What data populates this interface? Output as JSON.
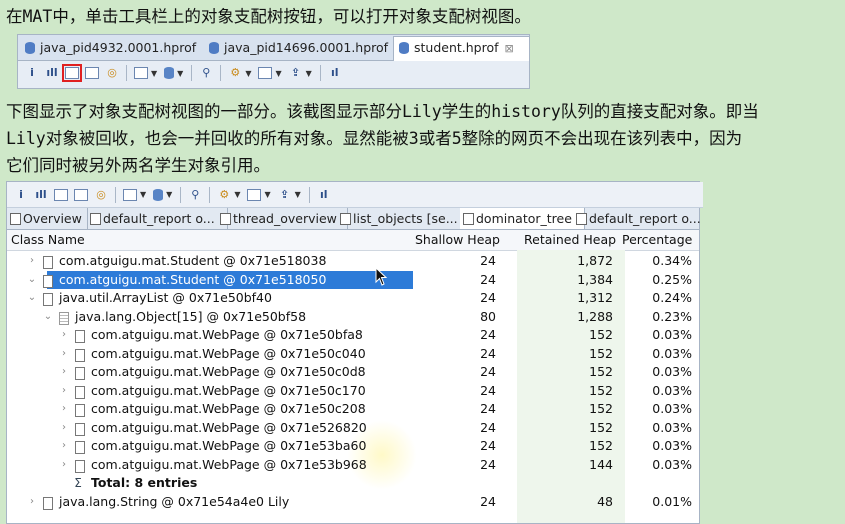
{
  "intro": {
    "line1_a": "在",
    "line1_mat": "MAT",
    "line1_b": "中，单击工具栏上的对象支配树按钮，可以打开对象支配树视图。"
  },
  "editor_tabs": [
    {
      "label": "java_pid4932.0001.hprof"
    },
    {
      "label": "java_pid14696.0001.hprof"
    },
    {
      "label": "student.hprof",
      "close": "⊠"
    }
  ],
  "paragraph2": {
    "l1a": "下图显示了对象支配树视图的一部分。该截图显示部分",
    "l1b": "Lily",
    "l1c": "学生的",
    "l1d": "history",
    "l1e": "队列的直接支配对象。即当",
    "l2a": "Lily",
    "l2b": "对象被回收，也会一并回收的所有对象。显然能被",
    "l2c": "3",
    "l2d": "或者",
    "l2e": "5",
    "l2f": "整除的网页不会出现在该列表中，因为",
    "l3": "它们同时被另外两名学生对象引用。"
  },
  "view_tabs": [
    {
      "label": "Overview"
    },
    {
      "label": "default_report  o..."
    },
    {
      "label": "thread_overview"
    },
    {
      "label": "list_objects  [se..."
    },
    {
      "label": "dominator_tree"
    },
    {
      "label": "default_report  o..."
    }
  ],
  "columns": {
    "class_name": "Class Name",
    "shallow": "Shallow Heap",
    "retained": "Retained Heap",
    "percentage": "Percentage"
  },
  "rows": [
    {
      "name": "com.atguigu.mat.Student @ 0x71e518038",
      "shallow": "24",
      "retained": "1,872",
      "pct": "0.34%"
    },
    {
      "name": "com.atguigu.mat.Student @ 0x71e518050",
      "shallow": "24",
      "retained": "1,384",
      "pct": "0.25%"
    },
    {
      "name": "java.util.ArrayList @ 0x71e50bf40",
      "shallow": "24",
      "retained": "1,312",
      "pct": "0.24%"
    },
    {
      "name": "java.lang.Object[15] @ 0x71e50bf58",
      "shallow": "80",
      "retained": "1,288",
      "pct": "0.23%"
    },
    {
      "name": "com.atguigu.mat.WebPage @ 0x71e50bfa8",
      "shallow": "24",
      "retained": "152",
      "pct": "0.03%"
    },
    {
      "name": "com.atguigu.mat.WebPage @ 0x71e50c040",
      "shallow": "24",
      "retained": "152",
      "pct": "0.03%"
    },
    {
      "name": "com.atguigu.mat.WebPage @ 0x71e50c0d8",
      "shallow": "24",
      "retained": "152",
      "pct": "0.03%"
    },
    {
      "name": "com.atguigu.mat.WebPage @ 0x71e50c170",
      "shallow": "24",
      "retained": "152",
      "pct": "0.03%"
    },
    {
      "name": "com.atguigu.mat.WebPage @ 0x71e50c208",
      "shallow": "24",
      "retained": "152",
      "pct": "0.03%"
    },
    {
      "name": "com.atguigu.mat.WebPage @ 0x71e526820",
      "shallow": "24",
      "retained": "152",
      "pct": "0.03%"
    },
    {
      "name": "com.atguigu.mat.WebPage @ 0x71e53ba60",
      "shallow": "24",
      "retained": "152",
      "pct": "0.03%"
    },
    {
      "name": "com.atguigu.mat.WebPage @ 0x71e53b968",
      "shallow": "24",
      "retained": "144",
      "pct": "0.03%"
    },
    {
      "name": "Total: 8 entries",
      "shallow": "",
      "retained": "",
      "pct": ""
    },
    {
      "name": "java.lang.String @ 0x71e54a4e0  Lily",
      "shallow": "24",
      "retained": "48",
      "pct": "0.01%"
    }
  ],
  "colors": {
    "selection": "#2d7bd8",
    "background": "#cfe8c9",
    "highlight_box": "#e02020"
  }
}
